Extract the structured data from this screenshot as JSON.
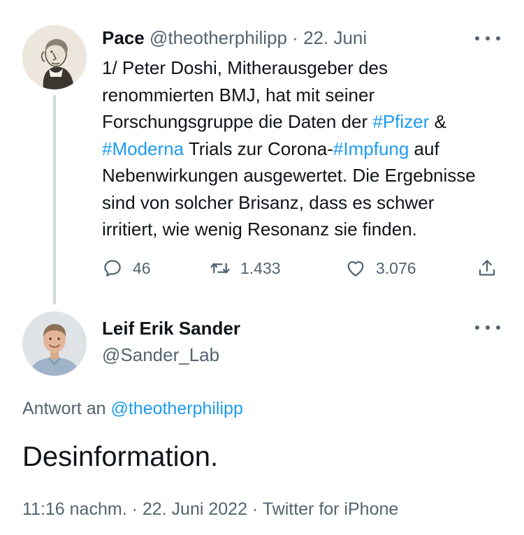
{
  "parent_tweet": {
    "author_name": "Pace",
    "handle": "@theotherphilipp",
    "separator": "·",
    "date": "22. Juni",
    "body": {
      "line1": "1/ Peter Doshi, Mitherausgeber des",
      "line2": "renommierten BMJ, hat mit seiner",
      "line3_text": "Forschungsgruppe die Daten der ",
      "line3_hashtag": "#Pfizer",
      "line3_after": " &",
      "line4_hashtag1": "#Moderna",
      "line4_mid": " Trials zur Corona-",
      "line4_hashtag2": "#Impfung",
      "line4_after": " auf",
      "line5": "Nebenwirkungen ausgewertet. Die Ergebnisse",
      "line6": "sind von solcher Brisanz, dass es schwer",
      "line7": "irritiert, wie wenig Resonanz sie finden."
    },
    "actions": {
      "replies": "46",
      "retweets": "1.433",
      "likes": "3.076"
    },
    "icons": {
      "avatar": "engraved-portrait-avatar",
      "more": "more-icon",
      "reply": "reply-icon",
      "retweet": "retweet-icon",
      "like": "heart-icon",
      "share": "share-icon"
    }
  },
  "reply_tweet": {
    "author_name": "Leif Erik Sander",
    "handle": "@Sander_Lab",
    "replying_to_label": "Antwort an ",
    "replying_to_handle": "@theotherphilipp",
    "text": "Desinformation.",
    "time": "11:16 nachm.",
    "separator1": " · ",
    "date": "22. Juni 2022",
    "separator2": " · ",
    "source": "Twitter for iPhone",
    "icons": {
      "avatar": "photo-avatar",
      "more": "more-icon"
    }
  },
  "colors": {
    "text_primary": "#0f1419",
    "text_secondary": "#536471",
    "link": "#1d9bf0",
    "thread_line": "#cfd9de",
    "background": "#ffffff"
  }
}
